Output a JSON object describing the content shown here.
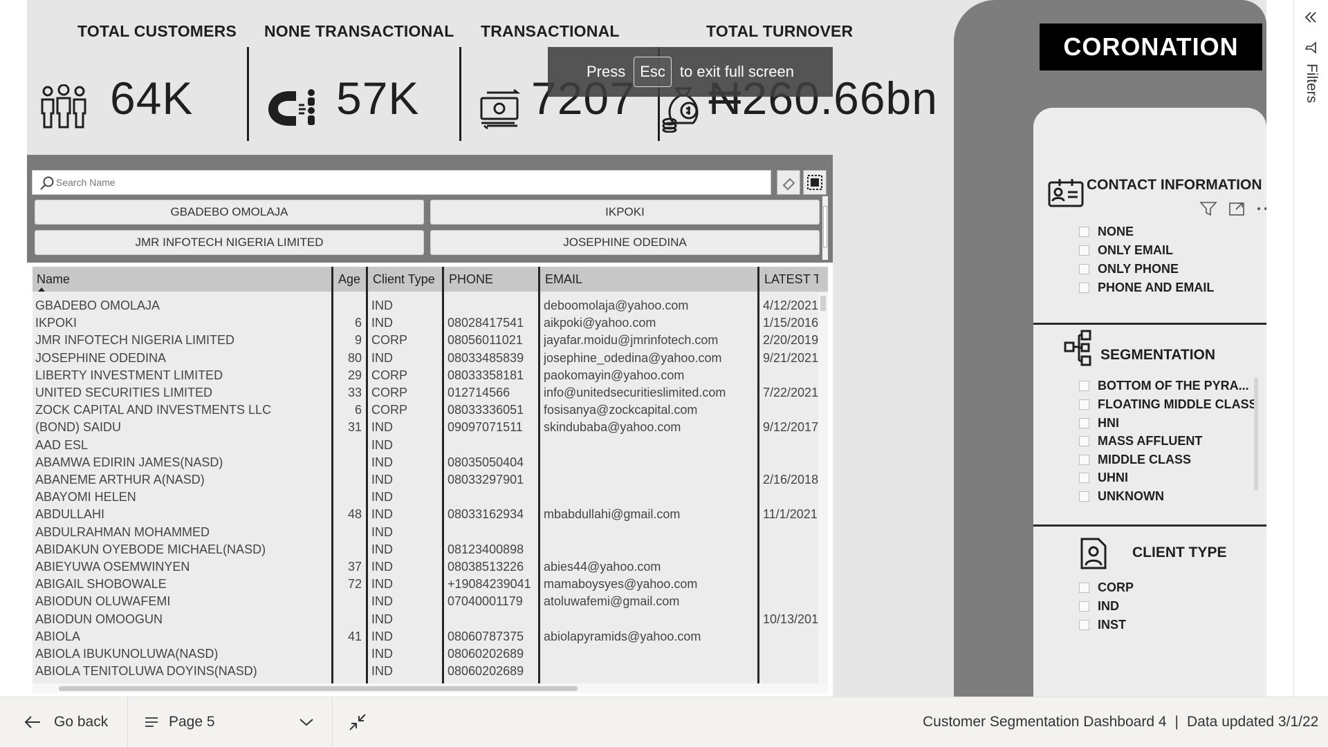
{
  "kpis": {
    "total_customers": {
      "title": "TOTAL CUSTOMERS",
      "value": "64K"
    },
    "none_transactional": {
      "title": "NONE TRANSACTIONAL",
      "value": "57K"
    },
    "transactional": {
      "title": "TRANSACTIONAL",
      "value": "7207"
    },
    "total_turnover": {
      "title": "TOTAL TURNOVER",
      "value": "₦260.66bn"
    }
  },
  "toast": {
    "prefix": "Press",
    "key": "Esc",
    "suffix": "to exit full screen"
  },
  "search": {
    "placeholder": "Search Name"
  },
  "name_buttons": [
    "GBADEBO OMOLAJA",
    "IKPOKI",
    "JMR INFOTECH NIGERIA LIMITED",
    "JOSEPHINE ODEDINA"
  ],
  "table": {
    "columns": [
      "Name",
      "Age",
      "Client Type",
      "PHONE",
      "EMAIL",
      "LATEST TR"
    ],
    "rows": [
      [
        "GBADEBO OMOLAJA",
        "",
        "IND",
        "",
        "deboomolaja@yahoo.com",
        "4/12/2021"
      ],
      [
        "IKPOKI",
        "6",
        "IND",
        "08028417541",
        "aikpoki@yahoo.com",
        "1/15/2016"
      ],
      [
        "JMR INFOTECH NIGERIA LIMITED",
        "9",
        "CORP",
        "08056011021",
        "jayafar.moidu@jmrinfotech.com",
        "2/20/2019"
      ],
      [
        "JOSEPHINE ODEDINA",
        "80",
        "IND",
        "08033485839",
        "josephine_odedina@yahoo.com",
        "9/21/2021"
      ],
      [
        "LIBERTY INVESTMENT LIMITED",
        "29",
        "CORP",
        "08033358181",
        "paokomayin@yahoo.com",
        ""
      ],
      [
        "UNITED SECURITIES LIMITED",
        "33",
        "CORP",
        "012714566",
        "info@unitedsecuritieslimited.com",
        "7/22/2021"
      ],
      [
        "ZOCK CAPITAL AND INVESTMENTS LLC",
        "6",
        "CORP",
        "08033336051",
        "fosisanya@zockcapital.com",
        ""
      ],
      [
        "(BOND) SAIDU",
        "31",
        "IND",
        "09097071511",
        "skindubaba@yahoo.com",
        "9/12/2017"
      ],
      [
        "AAD ESL",
        "",
        "IND",
        "",
        "",
        ""
      ],
      [
        "ABAMWA EDIRIN JAMES(NASD)",
        "",
        "IND",
        "08035050404",
        "",
        ""
      ],
      [
        "ABANEME ARTHUR A(NASD)",
        "",
        "IND",
        "08033297901",
        "",
        "2/16/2018"
      ],
      [
        "ABAYOMI HELEN",
        "",
        "IND",
        "",
        "",
        ""
      ],
      [
        "ABDULLAHI",
        "48",
        "IND",
        "08033162934",
        "mbabdullahi@gmail.com",
        "11/1/2021"
      ],
      [
        "ABDULRAHMAN MOHAMMED",
        "",
        "IND",
        "",
        "",
        ""
      ],
      [
        "ABIDAKUN OYEBODE MICHAEL(NASD)",
        "",
        "IND",
        "08123400898",
        "",
        ""
      ],
      [
        "ABIEYUWA OSEMWINYEN",
        "37",
        "IND",
        "08038513226",
        "abies44@yahoo.com",
        ""
      ],
      [
        "ABIGAIL SHOBOWALE",
        "72",
        "IND",
        "+19084239041",
        "mamaboysyes@yahoo.com",
        ""
      ],
      [
        "ABIODUN OLUWAFEMI",
        "",
        "IND",
        "07040001179",
        "atoluwafemi@gmail.com",
        ""
      ],
      [
        "ABIODUN OMOOGUN",
        "",
        "IND",
        "",
        "",
        "10/13/201"
      ],
      [
        "ABIOLA",
        "41",
        "IND",
        "08060787375",
        "abiolapyramids@yahoo.com",
        ""
      ],
      [
        "ABIOLA IBUKUNOLUWA(NASD)",
        "",
        "IND",
        "08060202689",
        "",
        ""
      ],
      [
        "ABIOLA TENITOLUWA DOYINS(NASD)",
        "",
        "IND",
        "08060202689",
        "",
        ""
      ]
    ]
  },
  "logo": {
    "text": "CORONATION"
  },
  "filters": {
    "contact_information": {
      "title": "CONTACT INFORMATION",
      "options": [
        "NONE",
        "ONLY EMAIL",
        "ONLY PHONE",
        "PHONE AND EMAIL"
      ]
    },
    "segmentation": {
      "title": "SEGMENTATION",
      "options": [
        "BOTTOM OF THE PYRA...",
        "FLOATING MIDDLE CLASS",
        "HNI",
        "MASS AFFLUENT",
        "MIDDLE CLASS",
        "UHNI",
        "UNKNOWN"
      ]
    },
    "client_type": {
      "title": "CLIENT TYPE",
      "options": [
        "CORP",
        "IND",
        "INST"
      ]
    }
  },
  "filters_pane": {
    "label": "Filters"
  },
  "bottom_bar": {
    "go_back": "Go back",
    "page": "Page 5",
    "report_name": "Customer Segmentation Dashboard 4",
    "separator": "|",
    "data_updated": "Data updated 3/1/22"
  }
}
